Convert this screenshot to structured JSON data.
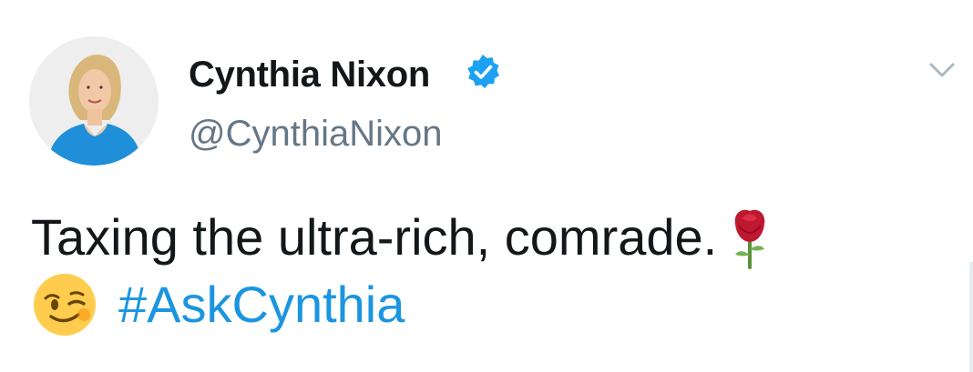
{
  "tweet": {
    "author": {
      "display_name": "Cynthia Nixon",
      "handle": "@CynthiaNixon",
      "verified": true,
      "avatar": "avatar-photo"
    },
    "text_line1": "Taxing the ultra-rich, comrade.",
    "hashtag": "#AskCynthia",
    "icons": {
      "verified": "verified-badge-icon",
      "menu": "chevron-down-icon",
      "rose": "rose-emoji-icon",
      "wink": "winking-face-emoji-icon"
    },
    "colors": {
      "link": "#1b95e0",
      "handle": "#657786",
      "text": "#14171a",
      "verified": "#1da1f2"
    }
  }
}
